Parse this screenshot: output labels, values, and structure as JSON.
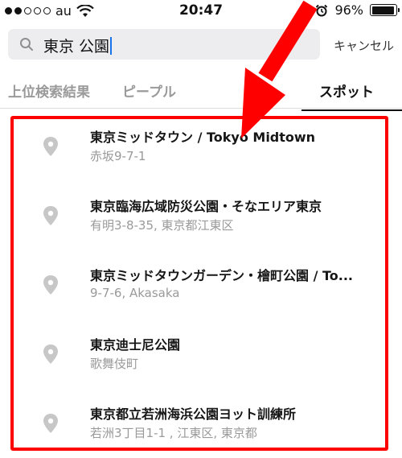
{
  "status_bar": {
    "carrier": "au",
    "time": "20:47",
    "battery": "96%",
    "battery_level": 0.96,
    "signal_bars_filled": 2,
    "signal_bars_total": 5
  },
  "search": {
    "query": "東京 公園",
    "cancel_label": "キャンセル"
  },
  "tabs": [
    {
      "label": "上位検索結果"
    },
    {
      "label": "ピープル"
    },
    {
      "label": "スポット"
    }
  ],
  "results": [
    {
      "title": "東京ミッドタウン / Tokyo Midtown",
      "subtitle": "赤坂9-7-1"
    },
    {
      "title": "東京臨海広域防災公園・そなエリア東京",
      "subtitle": "有明3-8-35, 東京都江東区"
    },
    {
      "title": "東京ミッドタウンガーデン・檜町公園 / To...",
      "subtitle": "9-7-6, Akasaka"
    },
    {
      "title": "東京迪士尼公園",
      "subtitle": "歌舞伎町"
    },
    {
      "title": "東京都立若洲海浜公園ヨット訓練所",
      "subtitle": "若洲3丁目1-1 , 江東区, 東京都"
    }
  ],
  "colors": {
    "annotation_red": "#ff0000",
    "pin_gray": "#c7c7c7"
  }
}
